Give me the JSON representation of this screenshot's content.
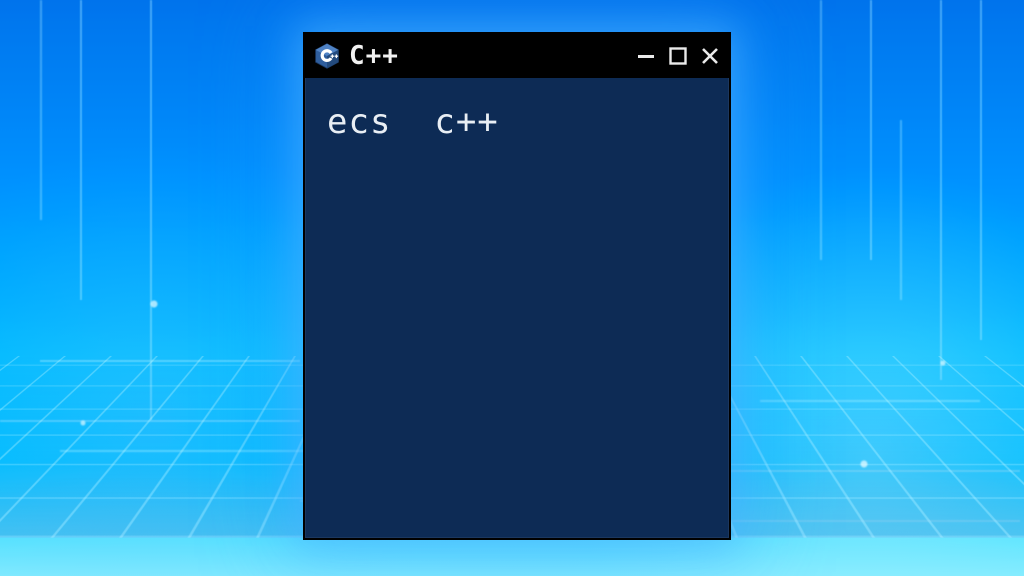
{
  "window": {
    "title": "C++",
    "icon": "cpp-hex-icon",
    "content_text": "ecs  c++"
  },
  "colors": {
    "window_bg": "#0d2b55",
    "titlebar_bg": "#000000",
    "text": "#e8eef4"
  }
}
